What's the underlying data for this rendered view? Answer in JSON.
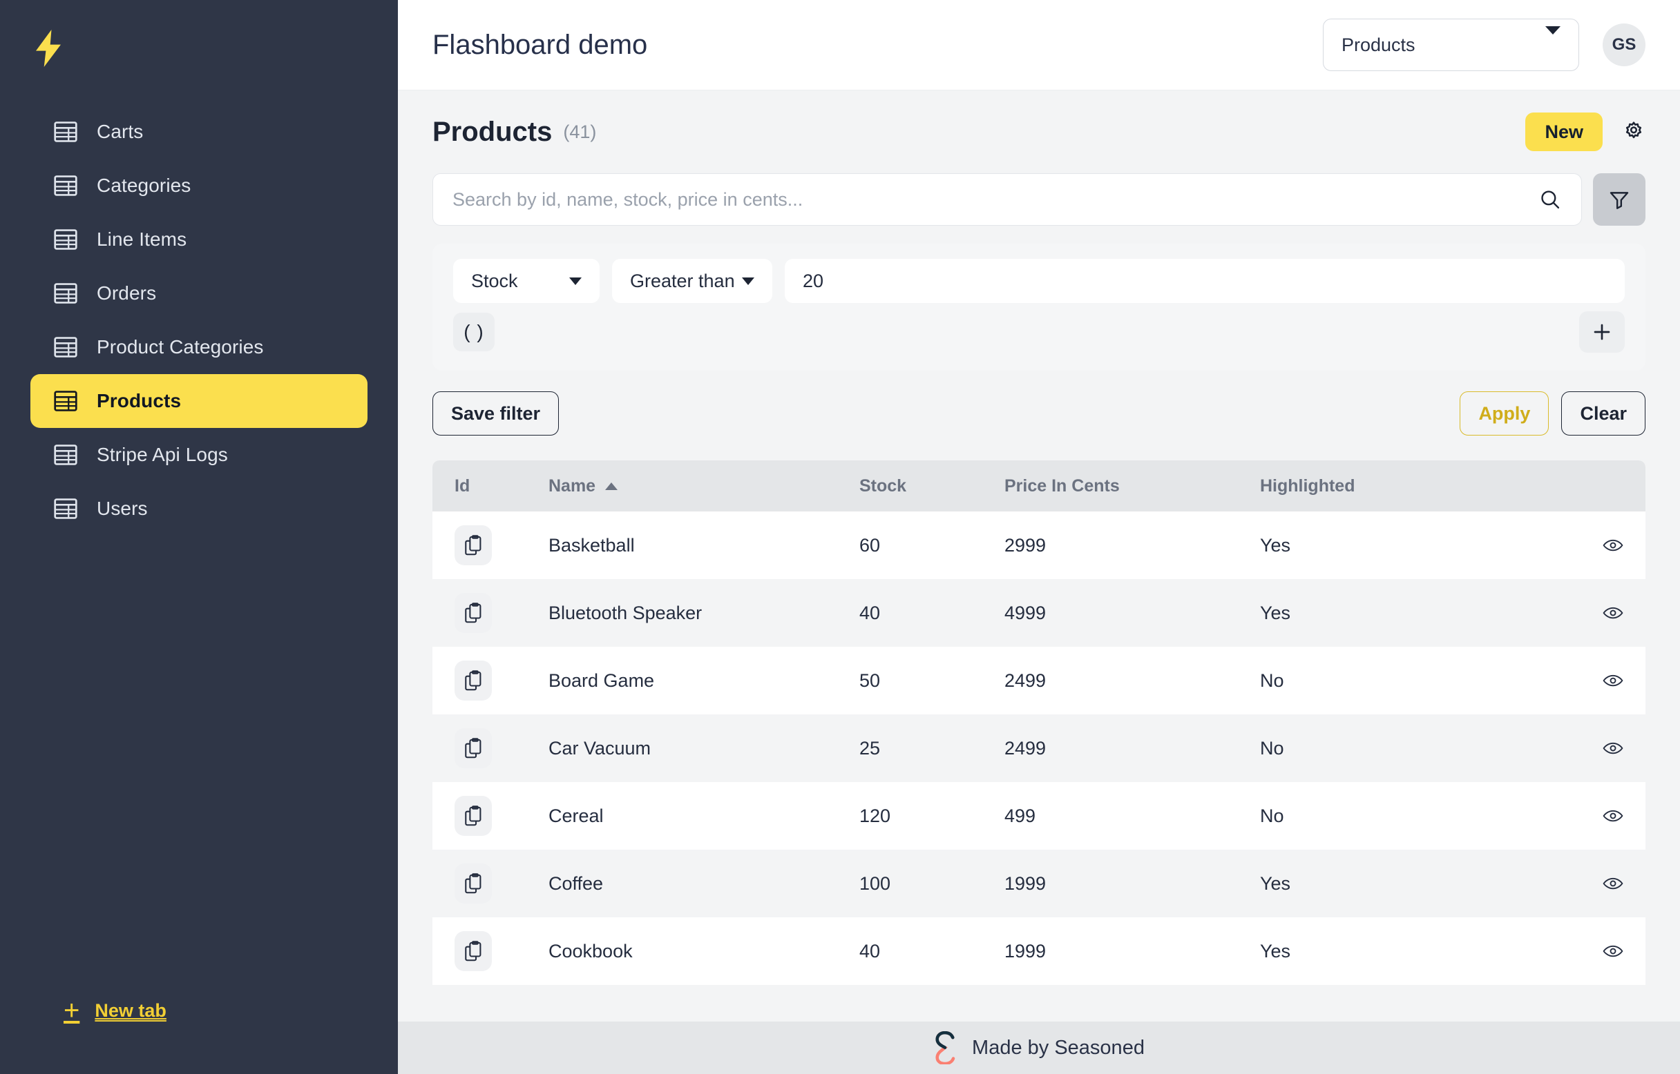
{
  "sidebar": {
    "logo_icon": "lightning-bolt-icon",
    "items": [
      {
        "label": "Carts",
        "icon": "table-icon",
        "active": false
      },
      {
        "label": "Categories",
        "icon": "table-icon",
        "active": false
      },
      {
        "label": "Line Items",
        "icon": "table-icon",
        "active": false
      },
      {
        "label": "Orders",
        "icon": "table-icon",
        "active": false
      },
      {
        "label": "Product Categories",
        "icon": "table-icon",
        "active": false
      },
      {
        "label": "Products",
        "icon": "table-icon",
        "active": true
      },
      {
        "label": "Stripe Api Logs",
        "icon": "table-icon",
        "active": false
      },
      {
        "label": "Users",
        "icon": "table-icon",
        "active": false
      }
    ],
    "new_tab": {
      "label": "New tab",
      "icon": "plus-icon"
    }
  },
  "topbar": {
    "app_title": "Flashboard demo",
    "table_select": {
      "value": "Products",
      "icon": "chevron-down-icon"
    },
    "avatar_initials": "GS"
  },
  "page": {
    "title": "Products",
    "count": "(41)",
    "new_button": "New",
    "settings_icon": "gear-icon"
  },
  "search": {
    "placeholder": "Search by id, name, stock, price in cents...",
    "value": "",
    "search_icon": "search-icon",
    "filter_icon": "funnel-icon"
  },
  "filter": {
    "column": "Stock",
    "operator": "Greater than",
    "value": "20",
    "paren_label": "( )",
    "add_icon": "plus-icon",
    "save_label": "Save filter",
    "apply_label": "Apply",
    "clear_label": "Clear"
  },
  "table": {
    "columns": [
      "Id",
      "Name",
      "Stock",
      "Price In Cents",
      "Highlighted"
    ],
    "sorted_column": "Name",
    "sort_direction": "asc",
    "row_copy_icon": "copy-icon",
    "row_view_icon": "eye-icon",
    "rows": [
      {
        "name": "Basketball",
        "stock": "60",
        "price": "2999",
        "highlighted": "Yes"
      },
      {
        "name": "Bluetooth Speaker",
        "stock": "40",
        "price": "4999",
        "highlighted": "Yes"
      },
      {
        "name": "Board Game",
        "stock": "50",
        "price": "2499",
        "highlighted": "No"
      },
      {
        "name": "Car Vacuum",
        "stock": "25",
        "price": "2499",
        "highlighted": "No"
      },
      {
        "name": "Cereal",
        "stock": "120",
        "price": "499",
        "highlighted": "No"
      },
      {
        "name": "Coffee",
        "stock": "100",
        "price": "1999",
        "highlighted": "Yes"
      },
      {
        "name": "Cookbook",
        "stock": "40",
        "price": "1999",
        "highlighted": "Yes"
      }
    ]
  },
  "footer": {
    "text": "Made by Seasoned",
    "logo_icon": "seasoned-s-logo"
  },
  "colors": {
    "accent_yellow": "#fbdf4e",
    "sidebar_bg": "#2f3647",
    "text_dark": "#1d2433",
    "muted": "#8a929e",
    "logo_coral": "#fa8072"
  }
}
